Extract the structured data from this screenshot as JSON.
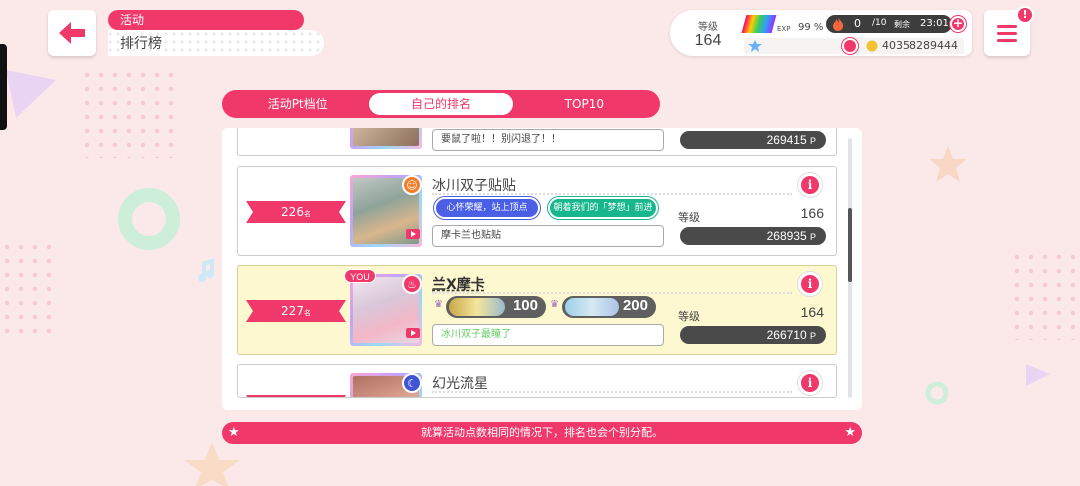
{
  "header": {
    "category": "活动",
    "title": "排行榜"
  },
  "status": {
    "level_label": "等级",
    "level": "164",
    "exp_label": "EXP",
    "exp_percent": "99 %",
    "stamina": "0",
    "stamina_max": "/10",
    "remaining_label": "剩余",
    "time": "23:01",
    "stars": "4035",
    "coins": "8289444"
  },
  "tabs": [
    {
      "label": "活动Pt档位",
      "active": false
    },
    {
      "label": "自己的排名",
      "active": true
    },
    {
      "label": "TOP10",
      "active": false
    }
  ],
  "rankings": {
    "level_label": "等级",
    "rank_suffix": "名",
    "points_suffix": "P",
    "you_label": "YOU",
    "partial_top": {
      "comment": "要鼠了啦！！别闪退了！！",
      "points": "269415"
    },
    "rows": [
      {
        "rank": "226",
        "name": "冰川双子贴贴",
        "badge1": "心怀荣耀，站上顶点",
        "badge2": "朝着我们的「梦想」前进",
        "level": "166",
        "comment": "摩卡兰也贴贴",
        "points": "268935"
      },
      {
        "rank": "227",
        "name": "兰X摩卡",
        "trophy1": "100",
        "trophy2": "200",
        "level": "164",
        "comment": "冰川双子最瞳了",
        "points": "266710"
      },
      {
        "name": "幻光流星"
      }
    ]
  },
  "footer_note": "就算活动点数相同的情况下，排名也会个别分配。",
  "colors": {
    "accent": "#f0386b",
    "dark_pill": "#4a4a4a",
    "self_row": "#fdf8cf"
  }
}
